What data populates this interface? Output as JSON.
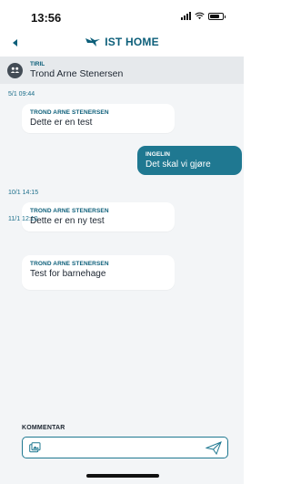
{
  "status": {
    "time": "13:56"
  },
  "header": {
    "brand": "IST HOME"
  },
  "contact": {
    "role": "TIRIL",
    "name": "Trond Arne Stenersen"
  },
  "messages": [
    {
      "timestamp": "5/1 09:44",
      "sender": "TROND ARNE STENERSEN",
      "text": "Dette er en test",
      "direction": "incoming"
    },
    {
      "timestamp": "",
      "sender": "INGELIN",
      "text": "Det skal vi gjøre",
      "direction": "outgoing"
    },
    {
      "timestamp": "10/1 14:15",
      "sender": "TROND ARNE STENERSEN",
      "text": "Dette er en ny test",
      "direction": "incoming"
    },
    {
      "timestamp": "11/1 12:10",
      "sender": "TROND ARNE STENERSEN",
      "text": "Test for barnehage",
      "direction": "incoming"
    }
  ],
  "composer": {
    "label": "KOMMENTAR",
    "value": ""
  },
  "colors": {
    "accent": "#1f7891",
    "brand": "#0d5f7a",
    "background": "#f3f5f7"
  },
  "icons": {
    "back": "back-arrow-icon",
    "logo": "bird-icon",
    "avatar": "group-icon",
    "attach": "image-icon",
    "send": "paper-plane-icon"
  }
}
